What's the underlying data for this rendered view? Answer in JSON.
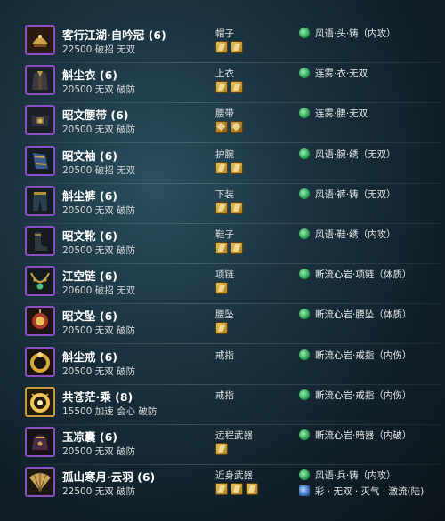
{
  "items": [
    {
      "name": "客行江湖·自吟冠 (6)",
      "attrs": "22500 破招 无双",
      "slot": "帽子",
      "sockets": 2,
      "sock_style": "gold",
      "enchant": "风语·头·铸（内攻）",
      "icon": "hat-icon",
      "frame": "purple"
    },
    {
      "name": "斛尘衣 (6)",
      "attrs": "20500 无双 破防",
      "slot": "上衣",
      "sockets": 2,
      "sock_style": "gold",
      "enchant": "连雾·衣·无双",
      "icon": "robe-icon",
      "frame": "purple"
    },
    {
      "name": "昭文腰带 (6)",
      "attrs": "20500 无双 破防",
      "slot": "腰带",
      "sockets": 2,
      "sock_style": "diamond",
      "enchant": "连雾·腰·无双",
      "icon": "belt-icon",
      "frame": "purple"
    },
    {
      "name": "昭文袖 (6)",
      "attrs": "20500 破招 无双",
      "slot": "护腕",
      "sockets": 2,
      "sock_style": "gold",
      "enchant": "风语·腕·绣（无双）",
      "icon": "bracer-icon",
      "frame": "purple"
    },
    {
      "name": "斛尘裤 (6)",
      "attrs": "20500 无双 破防",
      "slot": "下装",
      "sockets": 2,
      "sock_style": "gold",
      "enchant": "风语·裤·铸（无双）",
      "icon": "pants-icon",
      "frame": "purple"
    },
    {
      "name": "昭文靴 (6)",
      "attrs": "20500 无双 破防",
      "slot": "鞋子",
      "sockets": 2,
      "sock_style": "gold",
      "enchant": "风语·鞋·绣（内攻）",
      "icon": "boots-icon",
      "frame": "purple"
    },
    {
      "name": "江空链 (6)",
      "attrs": "20600 破招 无双",
      "slot": "项链",
      "sockets": 1,
      "sock_style": "gold",
      "enchant": "断流心岩·项链（体质）",
      "icon": "necklace-icon",
      "frame": "purple"
    },
    {
      "name": "昭文坠 (6)",
      "attrs": "20500 无双 破防",
      "slot": "腰坠",
      "sockets": 1,
      "sock_style": "gold",
      "enchant": "断流心岩·腰坠（体质）",
      "icon": "pendant-icon",
      "frame": "purple"
    },
    {
      "name": "斛尘戒 (6)",
      "attrs": "20500 无双 破防",
      "slot": "戒指",
      "sockets": 0,
      "sock_style": "gold",
      "enchant": "断流心岩·戒指（内伤）",
      "icon": "ring-icon",
      "frame": "purple"
    },
    {
      "name": "共苍茫·乘 (8)",
      "attrs": "15500 加速 会心 破防",
      "slot": "戒指",
      "sockets": 0,
      "sock_style": "gold",
      "enchant": "断流心岩·戒指（内伤）",
      "icon": "ring-gold-icon",
      "frame": "gold"
    },
    {
      "name": "玉凉囊 (6)",
      "attrs": "20500 无双 破防",
      "slot": "远程武器",
      "sockets": 1,
      "sock_style": "gold",
      "enchant": "断流心岩·暗器（内破）",
      "icon": "pouch-icon",
      "frame": "purple"
    },
    {
      "name": "孤山寒月·云羽 (6)",
      "attrs": "22500 无双 破防",
      "slot": "近身武器",
      "sockets": 3,
      "sock_style": "gold",
      "enchant": "风语·兵·铸（内攻）",
      "enchant2": "彩 · 无双 · 灭气 · 激流(陆)",
      "icon": "fan-icon",
      "frame": "purple"
    }
  ],
  "colors": {
    "purple_frame": "#8a4fc2",
    "gold_frame": "#c79a3a",
    "enchant_gem": "#27a04e",
    "colored_gem": "#3b72c0"
  }
}
